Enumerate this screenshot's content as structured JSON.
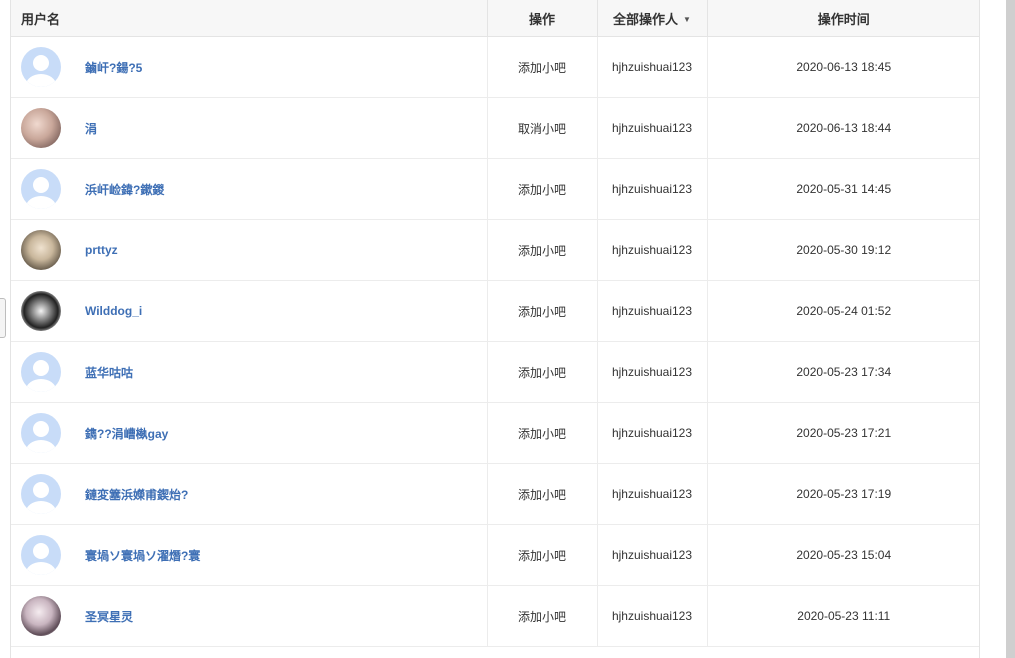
{
  "columns": {
    "user": "用户名",
    "operation": "操作",
    "operator": "全部操作人",
    "time": "操作时间"
  },
  "rows": [
    {
      "username": "鏀屽?鍚?5",
      "operation": "添加小吧",
      "operator": "hjhzuishuai123",
      "time": "2020-06-13 18:45",
      "avatar": "default-avatar-icon"
    },
    {
      "username": "涓",
      "operation": "取消小吧",
      "operator": "hjhzuishuai123",
      "time": "2020-06-13 18:44",
      "avatar": "user-photo-avatar"
    },
    {
      "username": "浜屽崄鍏?鏉鍐",
      "operation": "添加小吧",
      "operator": "hjhzuishuai123",
      "time": "2020-05-31 14:45",
      "avatar": "default-avatar-icon"
    },
    {
      "username": "prttyz",
      "operation": "添加小吧",
      "operator": "hjhzuishuai123",
      "time": "2020-05-30 19:12",
      "avatar": "user-photo-avatar"
    },
    {
      "username": "Wilddog_i",
      "operation": "添加小吧",
      "operator": "hjhzuishuai123",
      "time": "2020-05-24 01:52",
      "avatar": "user-photo-avatar"
    },
    {
      "username": "蓝华咕咕",
      "operation": "添加小吧",
      "operator": "hjhzuishuai123",
      "time": "2020-05-23 17:34",
      "avatar": "default-avatar-icon"
    },
    {
      "username": "鐫??涓嶆槸gay",
      "operation": "添加小吧",
      "operator": "hjhzuishuai123",
      "time": "2020-05-23 17:21",
      "avatar": "default-avatar-icon"
    },
    {
      "username": "鏈変簺浜嬫甫鍥炲?",
      "operation": "添加小吧",
      "operator": "hjhzuishuai123",
      "time": "2020-05-23 17:19",
      "avatar": "default-avatar-icon"
    },
    {
      "username": "寰堝ソ寰堝ソ濯熸?寰",
      "operation": "添加小吧",
      "operator": "hjhzuishuai123",
      "time": "2020-05-23 15:04",
      "avatar": "default-avatar-icon"
    },
    {
      "username": "圣冥星灵",
      "operation": "添加小吧",
      "operator": "hjhzuishuai123",
      "time": "2020-05-23 11:11",
      "avatar": "user-photo-avatar"
    }
  ],
  "colors": {
    "username_link": "#3e6fb5",
    "default_avatar_bg": "#c8dcf8",
    "header_bg": "#f7f7f7"
  }
}
